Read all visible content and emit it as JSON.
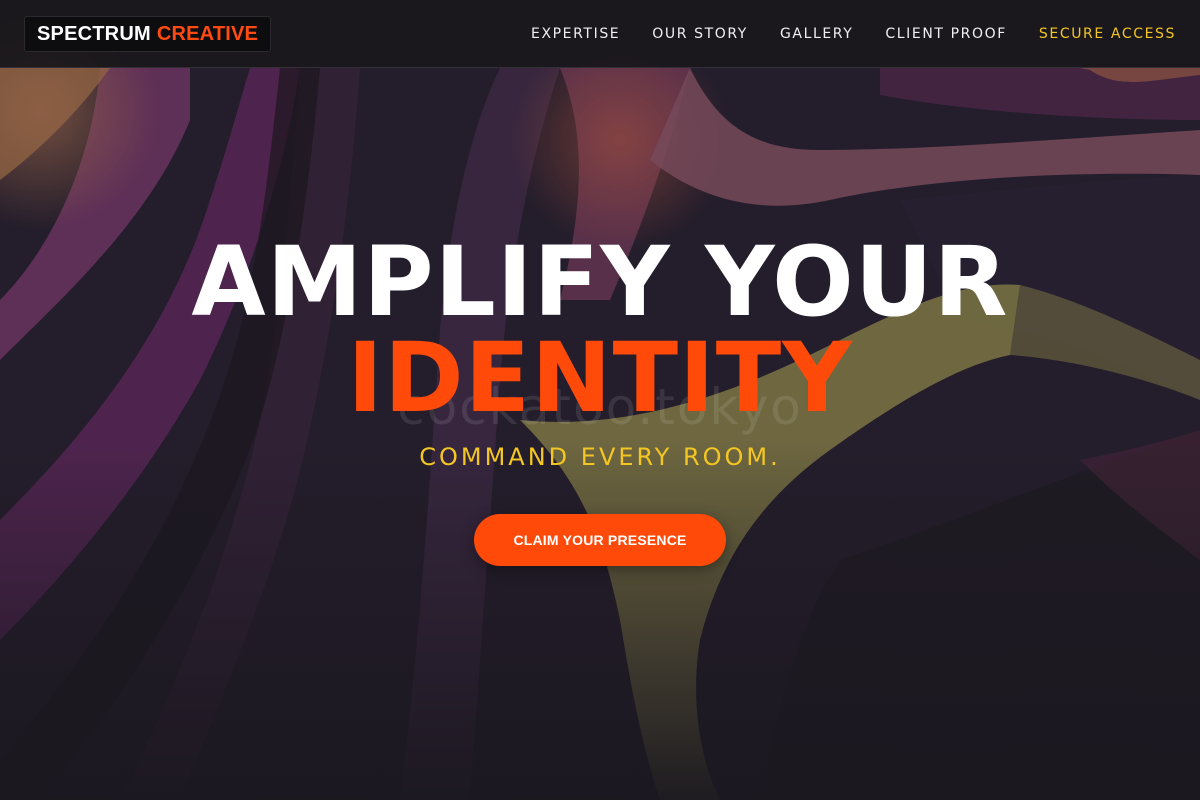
{
  "brand": {
    "name_primary": "SPECTRUM",
    "name_accent": "CREATIVE"
  },
  "nav": {
    "items": [
      {
        "label": "EXPERTISE"
      },
      {
        "label": "OUR STORY"
      },
      {
        "label": "GALLERY"
      },
      {
        "label": "CLIENT PROOF"
      },
      {
        "label": "SECURE ACCESS"
      }
    ]
  },
  "hero": {
    "headline_line1": "AMPLIFY YOUR",
    "headline_line2": "IDENTITY",
    "watermark": "cockatoo.tokyo",
    "tagline": "COMMAND EVERY ROOM.",
    "cta_label": "CLAIM YOUR PRESENCE"
  },
  "colors": {
    "accent": "#ff4a0a",
    "highlight": "#f3c624",
    "header_bg": "#1a181c",
    "hero_bg": "#2a2233"
  }
}
